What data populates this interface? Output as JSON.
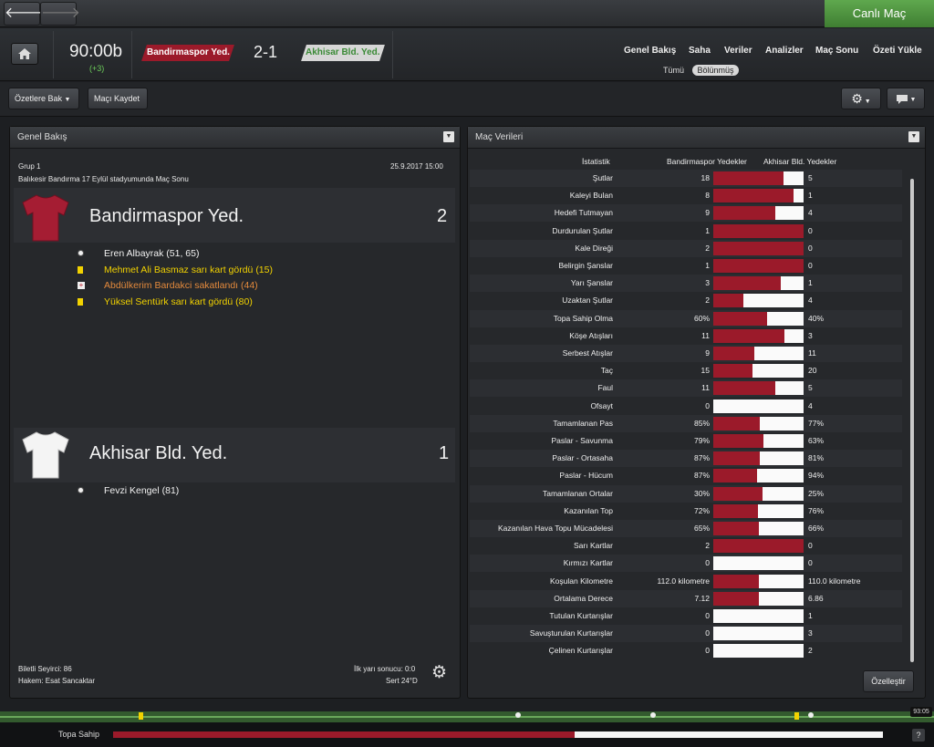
{
  "topbar": {
    "back_glyph": "🡐",
    "forward_glyph": "🡒",
    "live_label": "Canlı Maç"
  },
  "header": {
    "clock": "90:00b",
    "added_time": "(+3)",
    "home_team": "Bandirmaspor Yed.",
    "score": "2-1",
    "away_team": "Akhisar Bld. Yed.",
    "nav": [
      "Genel Bakış",
      "Saha",
      "Veriler",
      "Analizler",
      "Maç Sonu",
      "Özeti Yükle"
    ],
    "subtabs": [
      "Tümü",
      "Bölünmüş"
    ]
  },
  "toolbar": {
    "summaries_label": "Özetlere Bak",
    "save_label": "Maçı Kaydet"
  },
  "overview": {
    "title": "Genel Bakış",
    "group": "Grup 1",
    "datetime": "25.9.2017 15:00",
    "venue": "Balıkesir Bandırma 17 Eylül stadyumunda Maç Sonu",
    "home": {
      "name": "Bandirmaspor Yed.",
      "goals": "2",
      "kit_color": "#a51d33",
      "events": [
        {
          "icon": "goal-icon",
          "text": "Eren Albayrak (51, 65)",
          "color": "#f0f0f0"
        },
        {
          "icon": "yellow-card-icon",
          "text": "Mehmet Ali Basmaz sarı kart gördü (15)",
          "color": "#f2d200"
        },
        {
          "icon": "injury-icon",
          "text": "Abdülkerim Bardakci sakatlandı (44)",
          "color": "#e48a3c"
        },
        {
          "icon": "yellow-card-icon",
          "text": "Yüksel Sentürk sarı kart gördü (80)",
          "color": "#f2d200"
        }
      ]
    },
    "away": {
      "name": "Akhisar Bld. Yed.",
      "goals": "1",
      "kit_color": "#f4f4f4",
      "events": [
        {
          "icon": "goal-icon",
          "text": "Fevzi Kengel (81)",
          "color": "#f0f0f0"
        }
      ]
    },
    "attendance": "Biletli Seyirci: 86",
    "referee": "Hakem: Esat Sancaktar",
    "halftime": "İlk yarı sonucu: 0:0",
    "weather": "Sert 24°D"
  },
  "match_stats": {
    "title": "Maç Verileri",
    "col_stat": "İstatistik",
    "col_home": "Bandirmaspor Yedekler",
    "col_away": "Akhisar Bld. Yedekler",
    "customize_label": "Özelleştir",
    "rows": [
      {
        "label": "Şutlar",
        "home": "18",
        "away": "5",
        "home_share": 0.78
      },
      {
        "label": "Kaleyi Bulan",
        "home": "8",
        "away": "1",
        "home_share": 0.89
      },
      {
        "label": "Hedefi Tutmayan",
        "home": "9",
        "away": "4",
        "home_share": 0.69
      },
      {
        "label": "Durdurulan Şutlar",
        "home": "1",
        "away": "0",
        "home_share": 1.0
      },
      {
        "label": "Kale Direği",
        "home": "2",
        "away": "0",
        "home_share": 1.0
      },
      {
        "label": "Belirgin Şanslar",
        "home": "1",
        "away": "0",
        "home_share": 1.0
      },
      {
        "label": "Yarı Şanslar",
        "home": "3",
        "away": "1",
        "home_share": 0.75
      },
      {
        "label": "Uzaktan Şutlar",
        "home": "2",
        "away": "4",
        "home_share": 0.33
      },
      {
        "label": "Topa Sahip Olma",
        "home": "60%",
        "away": "40%",
        "home_share": 0.6
      },
      {
        "label": "Köşe Atışları",
        "home": "11",
        "away": "3",
        "home_share": 0.79
      },
      {
        "label": "Serbest Atışlar",
        "home": "9",
        "away": "11",
        "home_share": 0.45
      },
      {
        "label": "Taç",
        "home": "15",
        "away": "20",
        "home_share": 0.43
      },
      {
        "label": "Faul",
        "home": "11",
        "away": "5",
        "home_share": 0.69
      },
      {
        "label": "Ofsayt",
        "home": "0",
        "away": "4",
        "home_share": 0.0
      },
      {
        "label": "Tamamlanan Pas",
        "home": "85%",
        "away": "77%",
        "home_share": 0.52
      },
      {
        "label": "Paslar - Savunma",
        "home": "79%",
        "away": "63%",
        "home_share": 0.56
      },
      {
        "label": "Paslar - Ortasaha",
        "home": "87%",
        "away": "81%",
        "home_share": 0.52
      },
      {
        "label": "Paslar - Hücum",
        "home": "87%",
        "away": "94%",
        "home_share": 0.48
      },
      {
        "label": "Tamamlanan Ortalar",
        "home": "30%",
        "away": "25%",
        "home_share": 0.55
      },
      {
        "label": "Kazanılan Top",
        "home": "72%",
        "away": "76%",
        "home_share": 0.49
      },
      {
        "label": "Kazanılan Hava Topu Mücadelesi",
        "home": "65%",
        "away": "66%",
        "home_share": 0.5
      },
      {
        "label": "Sarı Kartlar",
        "home": "2",
        "away": "0",
        "home_share": 1.0
      },
      {
        "label": "Kırmızı Kartlar",
        "home": "0",
        "away": "0",
        "home_share": 0.0
      },
      {
        "label": "Koşulan Kilometre",
        "home": "112.0 kilometre",
        "away": "110.0 kilometre",
        "home_share": 0.5
      },
      {
        "label": "Ortalama Derece",
        "home": "7.12",
        "away": "6.86",
        "home_share": 0.51
      },
      {
        "label": "Tutulan Kurtarışlar",
        "home": "0",
        "away": "1",
        "home_share": 0.0
      },
      {
        "label": "Savuşturulan Kurtarışlar",
        "home": "0",
        "away": "3",
        "home_share": 0.0
      },
      {
        "label": "Çelinen Kurtarışlar",
        "home": "0",
        "away": "2",
        "home_share": 0.0
      }
    ]
  },
  "timeline": {
    "time_label": "93:05"
  },
  "bottom": {
    "possession_label": "Topa Sahip",
    "home_possession": 0.6,
    "help_label": "?"
  },
  "colors": {
    "home": "#9b1a2a",
    "away": "#fafafa",
    "accent": "#4f9a40"
  }
}
